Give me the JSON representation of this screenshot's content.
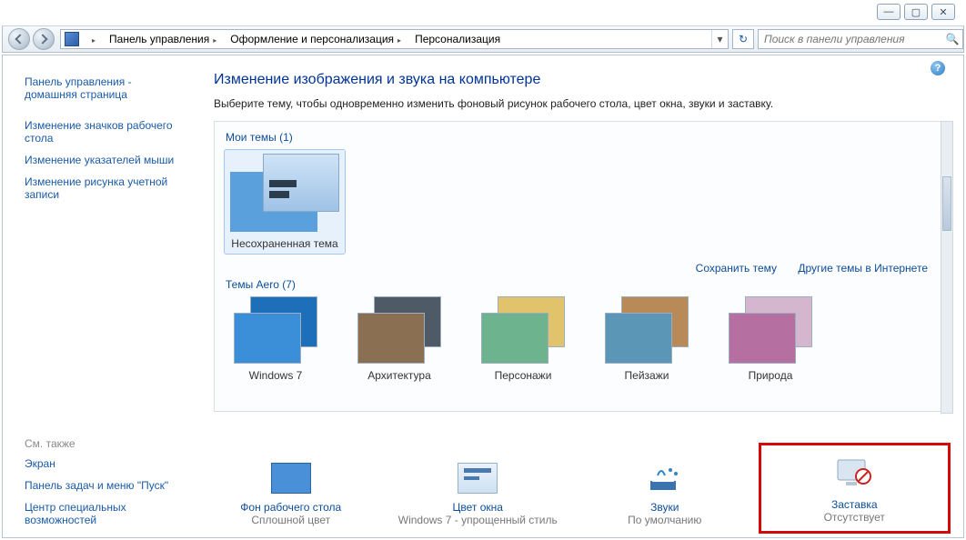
{
  "caption": {
    "min": "—",
    "max": "▢",
    "close": "✕"
  },
  "breadcrumbs": {
    "root": "Панель управления",
    "mid": "Оформление и персонализация",
    "leaf": "Персонализация"
  },
  "search": {
    "placeholder": "Поиск в панели управления"
  },
  "refresh_glyph": "↻",
  "search_glyph": "🔍",
  "help_glyph": "?",
  "sidebar": {
    "home1": "Панель управления -",
    "home2": "домашняя страница",
    "links": [
      "Изменение значков рабочего стола",
      "Изменение указателей мыши",
      "Изменение рисунка учетной записи"
    ],
    "see_also_label": "См. также",
    "see_also": [
      "Экран",
      "Панель задач и меню \"Пуск\"",
      "Центр специальных возможностей"
    ]
  },
  "content": {
    "heading": "Изменение изображения и звука на компьютере",
    "subhead": "Выберите тему, чтобы одновременно изменить фоновый рисунок рабочего стола, цвет окна, звуки и заставку.",
    "my_themes_label": "Мои темы (1)",
    "unsaved_theme": "Несохраненная тема",
    "save_theme": "Сохранить тему",
    "online_themes": "Другие темы в Интернете",
    "aero_label": "Темы Aero (7)",
    "aero": [
      {
        "name": "Windows 7",
        "c1": "#3b8fd9",
        "c2": "#1e6fb9"
      },
      {
        "name": "Архитектура",
        "c1": "#8a6f52",
        "c2": "#4e5a66"
      },
      {
        "name": "Персонажи",
        "c1": "#6db38d",
        "c2": "#e0c36b"
      },
      {
        "name": "Пейзажи",
        "c1": "#5b96b6",
        "c2": "#b78a57"
      },
      {
        "name": "Природа",
        "c1": "#b56fa1",
        "c2": "#d4b6cf"
      }
    ],
    "bottom": [
      {
        "label": "Фон рабочего стола",
        "status": "Сплошной цвет"
      },
      {
        "label": "Цвет окна",
        "status": "Windows 7 - упрощенный стиль"
      },
      {
        "label": "Звуки",
        "status": "По умолчанию"
      },
      {
        "label": "Заставка",
        "status": "Отсутствует"
      }
    ]
  }
}
